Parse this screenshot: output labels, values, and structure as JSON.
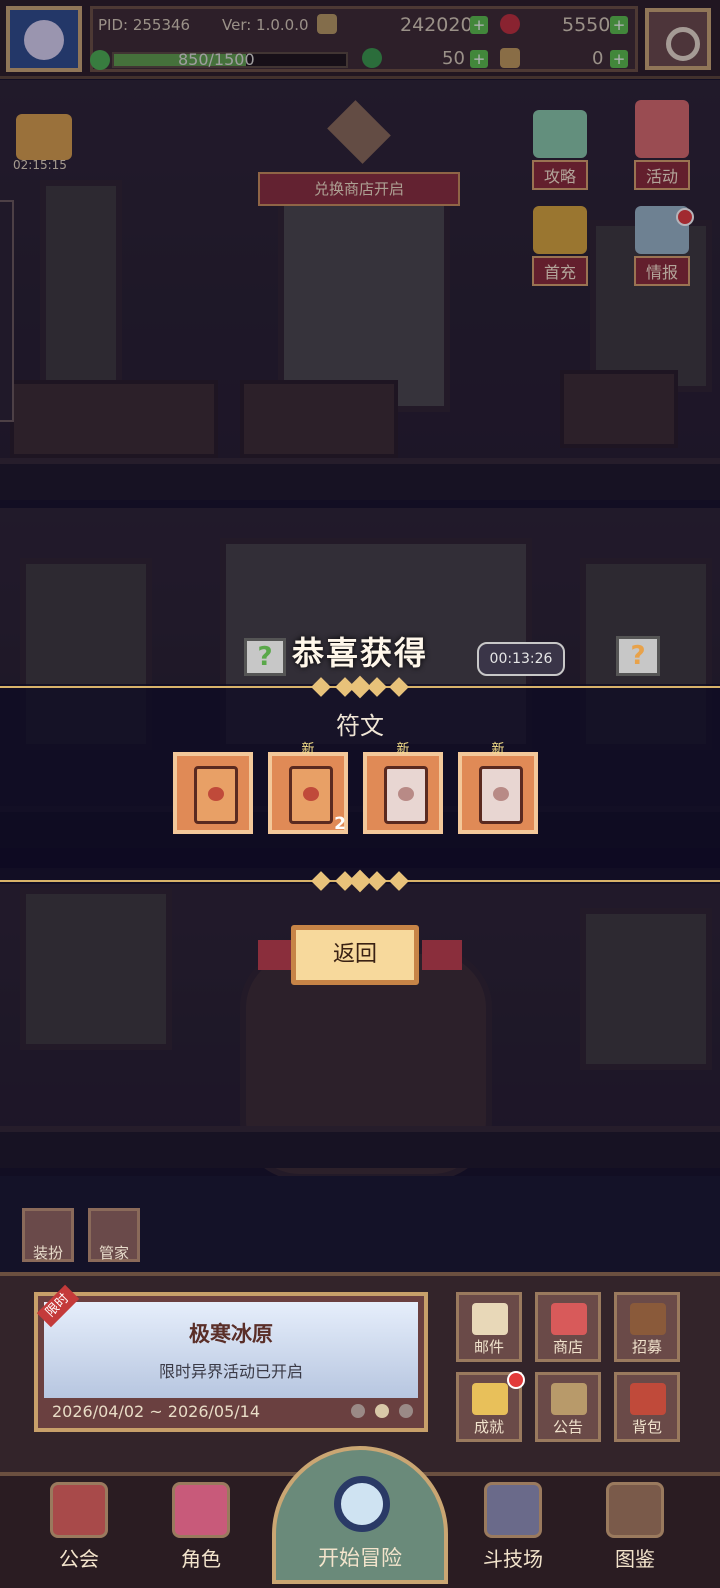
{
  "header": {
    "pid": "PID: 255346",
    "version": "Ver: 1.0.0.0",
    "gold": "242020",
    "gems": "5550",
    "xp": "850/1500",
    "xp_progress": 0.567,
    "clover": "50",
    "key_item": "0"
  },
  "left_widgets": {
    "gift_timer": "02:15:15"
  },
  "right_widgets": [
    {
      "label": "攻略",
      "icon": "chat-bubble-icon"
    },
    {
      "label": "活动",
      "icon": "balloons-icon"
    },
    {
      "label": "首充",
      "icon": "gift-box-icon"
    },
    {
      "label": "情报",
      "icon": "newspaper-icon"
    }
  ],
  "scene": {
    "shop_banner": "兑换商店开启",
    "npc_timer": "00:13:26"
  },
  "reward_modal": {
    "title": "恭喜获得",
    "section": "符文",
    "new_label": "新",
    "items": [
      {
        "new": false,
        "qty": ""
      },
      {
        "new": true,
        "qty": "2"
      },
      {
        "new": true,
        "qty": ""
      },
      {
        "new": true,
        "qty": ""
      }
    ],
    "return_label": "返回"
  },
  "small_buttons": {
    "dress": "装扮",
    "butler": "管家"
  },
  "event": {
    "tag": "限时",
    "title": "极寒冰原",
    "subtitle": "限时异界活动已开启",
    "dates": "2026/04/02 ~ 2026/05/14"
  },
  "menu_grid": [
    {
      "label": "邮件",
      "icon": "mail-icon"
    },
    {
      "label": "商店",
      "icon": "shop-icon"
    },
    {
      "label": "招募",
      "icon": "recruit-icon"
    },
    {
      "label": "成就",
      "icon": "trophy-icon"
    },
    {
      "label": "公告",
      "icon": "megaphone-icon"
    },
    {
      "label": "背包",
      "icon": "backpack-icon"
    }
  ],
  "nav": {
    "guild": "公会",
    "character": "角色",
    "start": "开始冒险",
    "arena": "斗技场",
    "codex": "图鉴"
  },
  "colors": {
    "accent_gold": "#d8b36a",
    "button_red": "#8a2e3c",
    "card_orange": "#e08a56"
  }
}
